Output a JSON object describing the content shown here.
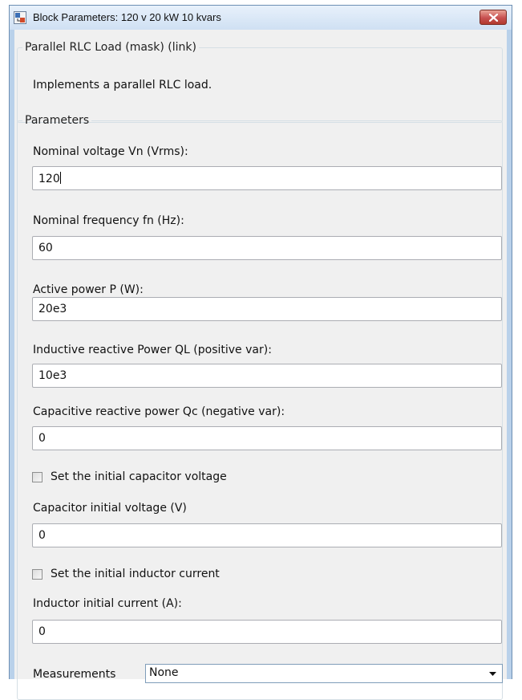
{
  "window": {
    "title": "Block Parameters: 120 v 20 kW 10 kvars",
    "app_icon": "simulink-block-icon",
    "close_icon": "close-icon"
  },
  "description": {
    "group_title": "Parallel RLC Load (mask) (link)",
    "text": "Implements a parallel RLC load."
  },
  "parameters": {
    "group_title": "Parameters",
    "nominal_voltage": {
      "label": "Nominal voltage Vn (Vrms):",
      "value": "120"
    },
    "nominal_frequency": {
      "label": "Nominal frequency fn (Hz):",
      "value": "60"
    },
    "active_power": {
      "label": "Active power P (W):",
      "value": "20e3"
    },
    "inductive_power": {
      "label": "Inductive reactive Power QL (positive var):",
      "value": "10e3"
    },
    "capacitive_power": {
      "label": "Capacitive reactive power Qc (negative var):",
      "value": "0"
    },
    "set_cap_voltage": {
      "label": "Set the initial capacitor voltage",
      "checked": false
    },
    "cap_initial_voltage": {
      "label": "Capacitor initial voltage (V)",
      "value": "0"
    },
    "set_ind_current": {
      "label": "Set the initial inductor current",
      "checked": false
    },
    "ind_initial_current": {
      "label": "Inductor initial current (A):",
      "value": "0"
    },
    "measurements": {
      "label": "Measurements",
      "selected": "None"
    }
  },
  "colors": {
    "frame": "#b9d1ea",
    "client": "#f0f0f0",
    "close_button": "#c75050"
  }
}
